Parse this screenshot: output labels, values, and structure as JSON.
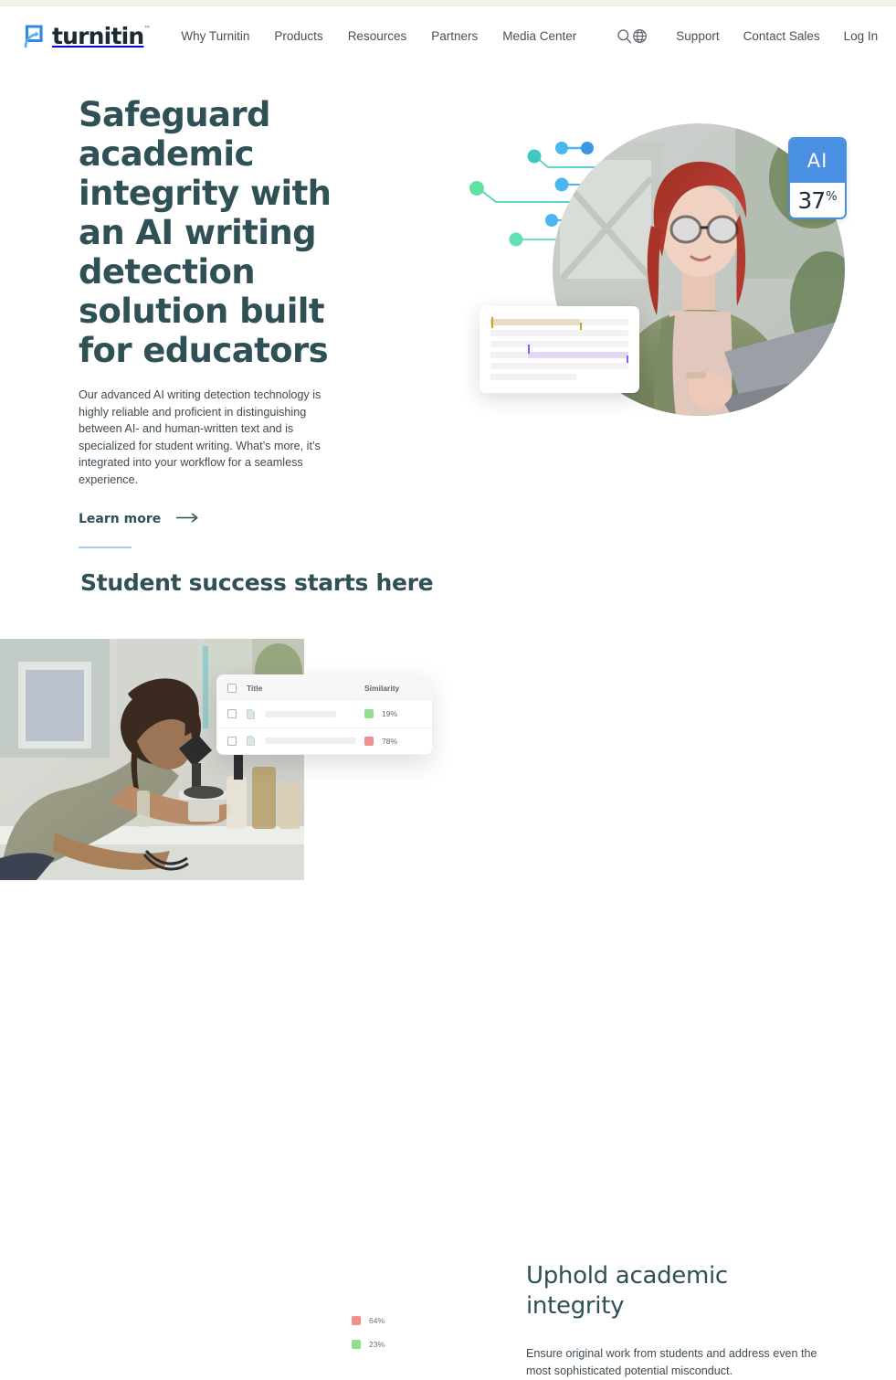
{
  "page": {
    "title": "Turnitin — Safeguard academic integrity",
    "background": "#ffffff",
    "top_strip_color": "#f4f4ec"
  },
  "header": {
    "logo": {
      "word": "turnitin",
      "trademark": "™",
      "icon": "turnitin-arrow-logo-icon",
      "color": "#2e8ae6"
    },
    "nav_items": [
      {
        "label": "Why Turnitin"
      },
      {
        "label": "Products"
      },
      {
        "label": "Resources"
      },
      {
        "label": "Partners"
      },
      {
        "label": "Media Center"
      }
    ],
    "search_icon": "search-icon",
    "globe_icon": "globe-icon",
    "right_items": [
      {
        "label": "Support"
      },
      {
        "label": "Contact Sales"
      },
      {
        "label": "Log In"
      }
    ]
  },
  "hero": {
    "title": "Safeguard academic integrity with an AI writing detection solution built for educators",
    "body": "Our advanced AI writing detection technology is highly reliable and proficient in distinguishing between AI- and human-written text and is specialized for student writing. What’s more, it’s integrated into your workflow for a seamless experience.",
    "cta_label": "Learn more",
    "cta_arrow": "arrow-right-icon",
    "title_color": "#2f5055",
    "ai_badge": {
      "label": "AI",
      "value": "37",
      "unit": "%",
      "accent": "#4a90e2"
    },
    "photo_alt": "woman-with-red-hair-and-glasses-typing-on-laptop",
    "doc_card_alt": "document-with-highlighted-passages"
  },
  "section2": {
    "eyebrow_divider_color": "#a8ccef",
    "title": "Student success starts here",
    "photo_alt": "student-looking-through-microscope-in-lab",
    "similarity_card": {
      "columns": [
        "Title",
        "Similarity"
      ],
      "rows": [
        {
          "similarity": "19%",
          "color": "#8ee08e"
        },
        {
          "similarity": "78%",
          "color": "#f0908e"
        }
      ],
      "extra_rows": [
        {
          "similarity": "64%",
          "color": "#f0908e"
        },
        {
          "similarity": "23%",
          "color": "#8ee08e"
        }
      ]
    },
    "right": {
      "heading": "Uphold academic integrity",
      "body": "Ensure original work from students and address even the most sophisticated potential misconduct."
    }
  }
}
